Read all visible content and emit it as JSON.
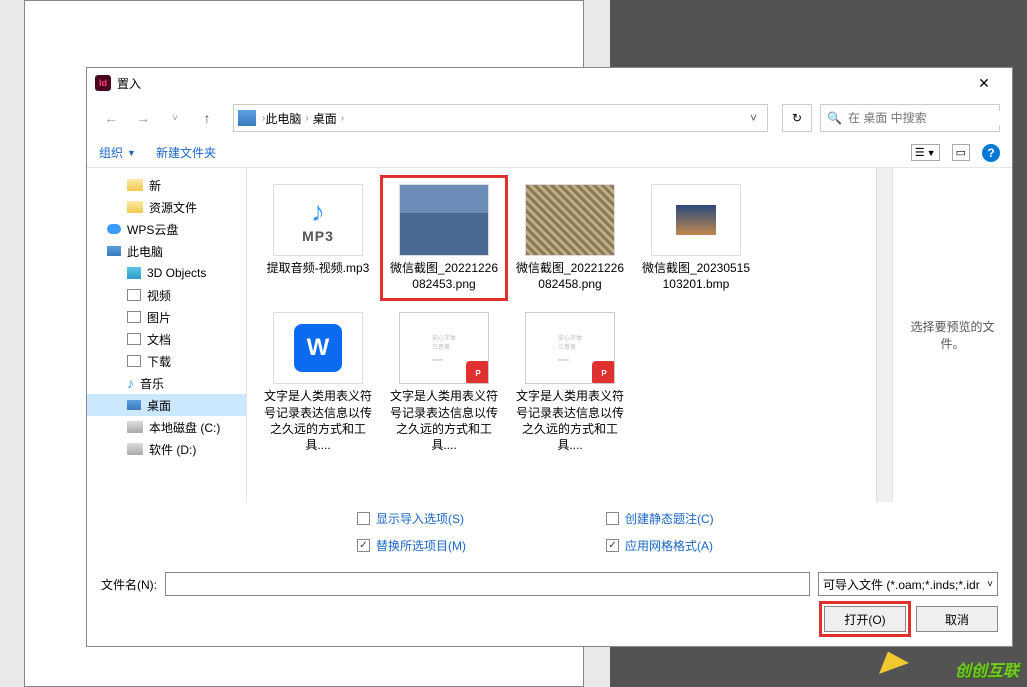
{
  "dialog": {
    "title": "置入"
  },
  "nav": {
    "breadcrumb": [
      "此电脑",
      "桌面"
    ],
    "search_placeholder": "在 桌面 中搜索"
  },
  "toolbar": {
    "organize": "组织",
    "new_folder": "新建文件夹"
  },
  "sidebar": [
    {
      "label": "新",
      "icon": "folder",
      "indent": 1
    },
    {
      "label": "资源文件",
      "icon": "folder",
      "indent": 1
    },
    {
      "label": "WPS云盘",
      "icon": "cloud",
      "indent": 0
    },
    {
      "label": "此电脑",
      "icon": "pc",
      "indent": 0
    },
    {
      "label": "3D Objects",
      "icon": "obj3d",
      "indent": 1
    },
    {
      "label": "视频",
      "icon": "media",
      "indent": 1
    },
    {
      "label": "图片",
      "icon": "media",
      "indent": 1
    },
    {
      "label": "文档",
      "icon": "media",
      "indent": 1
    },
    {
      "label": "下载",
      "icon": "media",
      "indent": 1
    },
    {
      "label": "音乐",
      "icon": "music",
      "indent": 1
    },
    {
      "label": "桌面",
      "icon": "pc",
      "indent": 1,
      "selected": true
    },
    {
      "label": "本地磁盘 (C:)",
      "icon": "drive",
      "indent": 1
    },
    {
      "label": "软件 (D:)",
      "icon": "drive",
      "indent": 1
    }
  ],
  "files": [
    {
      "name": "提取音频-视频.mp3",
      "type": "mp3"
    },
    {
      "name": "微信截图_20221226082453.png",
      "type": "img1",
      "highlighted": true
    },
    {
      "name": "微信截图_20221226082458.png",
      "type": "img2"
    },
    {
      "name": "微信截图_20230515103201.bmp",
      "type": "bmp"
    },
    {
      "name": "文字是人类用表义符号记录表达信息以传之久远的方式和工具....",
      "type": "wps"
    },
    {
      "name": "文字是人类用表义符号记录表达信息以传之久远的方式和工具....",
      "type": "pdf"
    },
    {
      "name": "文字是人类用表义符号记录表达信息以传之久远的方式和工具....",
      "type": "pdf"
    }
  ],
  "preview": {
    "placeholder": "选择要预览的文件。"
  },
  "options": {
    "show_import": "显示导入选项(S)",
    "replace_selected": "替换所选项目(M)",
    "create_caption": "创建静态题注(C)",
    "apply_grid": "应用网格格式(A)",
    "replace_checked": true,
    "apply_grid_checked": true
  },
  "footer": {
    "filename_label": "文件名(N):",
    "filename_value": "",
    "filetype": "可导入文件 (*.oam;*.inds;*.idr",
    "open_btn": "打开(O)",
    "cancel_btn": "取消"
  },
  "mp3_label": "MP3",
  "watermark": "创创互联"
}
